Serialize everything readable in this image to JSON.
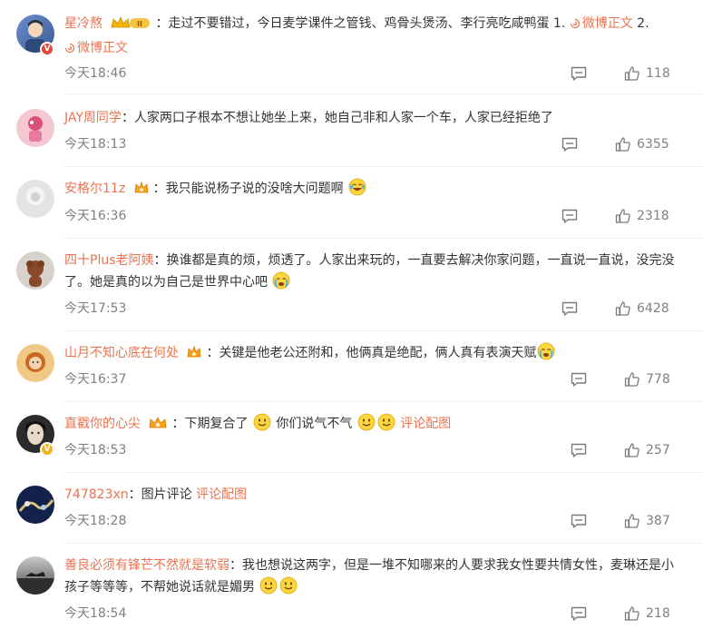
{
  "comments": [
    {
      "user": "星冷熬",
      "sep": "：",
      "text": "走过不要错过，今日麦学课件之管钱、鸡骨头煲汤、李行亮吃咸鸭蛋 1.",
      "link1": "微博正文",
      "mid": " 2.",
      "link2": "微博正文",
      "time": "今天18:46",
      "likes": "118",
      "crown_label": "II"
    },
    {
      "user": "JAY周同学",
      "sep": "：",
      "text": "人家两口子根本不想让她坐上来，她自己非和人家一个车，人家已经拒绝了",
      "time": "今天18:13",
      "likes": "6355"
    },
    {
      "user": "安格尔11z",
      "sep": "：",
      "text": "我只能说杨子说的没啥大问题啊",
      "time": "今天16:36",
      "likes": "2318"
    },
    {
      "user": "四十Plus老阿姨",
      "sep": "：",
      "text": "换谁都是真的烦，烦透了。人家出来玩的，一直要去解决你家问题，一直说一直说，没完没了。她是真的以为自己是世界中心吧",
      "time": "今天17:53",
      "likes": "6428"
    },
    {
      "user": "山月不知心底在何处",
      "sep": "：",
      "text": "关键是他老公还附和，他俩真是绝配，俩人真有表演天赋",
      "time": "今天16:37",
      "likes": "778"
    },
    {
      "user": "直戳你的心尖",
      "sep": "：",
      "text": "下期复合了",
      "text2": "你们说气不气",
      "link1": "评论配图",
      "time": "今天18:53",
      "likes": "257"
    },
    {
      "user": "747823xn",
      "sep": "：",
      "text": "图片评论",
      "link1": "评论配图",
      "time": "今天18:28",
      "likes": "387"
    },
    {
      "user": "善良必须有锋芒不然就是软弱",
      "sep": "：",
      "text": "我也想说这两字，但是一堆不知哪来的人要求我女性要共情女性，麦琳还是小孩子等等等，不帮她说话就是媚男",
      "time": "今天18:54",
      "likes": "218"
    }
  ],
  "icons": {
    "reply": "comment-bubble-icon",
    "like": "thumb-up-icon",
    "weibo": "weibo-logo-icon",
    "crown": "crown-badge-icon"
  },
  "colors": {
    "username": "#eb7350",
    "meta": "#808080",
    "text": "#333333"
  }
}
